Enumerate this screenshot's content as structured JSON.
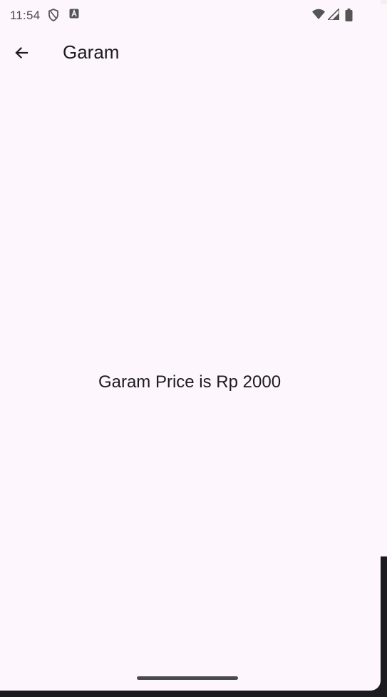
{
  "status_bar": {
    "time": "11:54",
    "left_icons": [
      "shield-icon",
      "app-notification-icon"
    ],
    "right_icons": [
      "wifi-icon",
      "cellular-signal-icon",
      "battery-icon"
    ]
  },
  "app_bar": {
    "back_icon": "arrow-back-icon",
    "title": "Garam"
  },
  "content": {
    "price_text": "Garam Price is Rp 2000"
  },
  "colors": {
    "background": "#fdf7fd",
    "text": "#1d1b20",
    "status_text": "#4a4a4a"
  }
}
